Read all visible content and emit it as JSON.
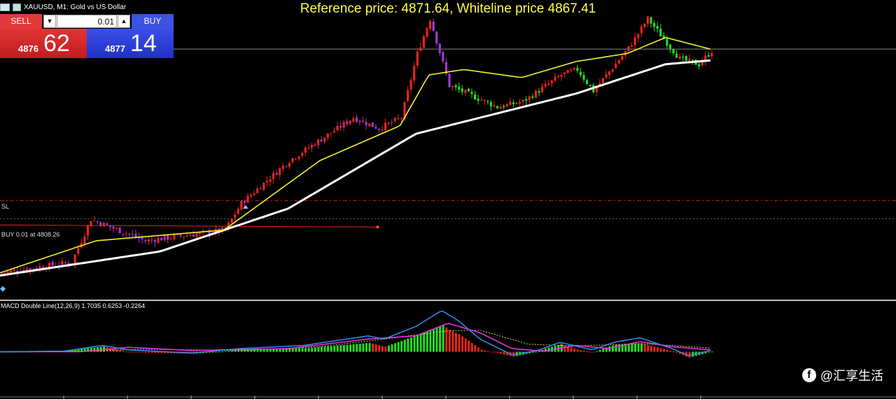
{
  "window": {
    "symbol_title": "XAUUSD, M1:  Gold vs US Dollar"
  },
  "header_text": "Reference price: 4871.64, Whiteline price 4867.41",
  "trade_panel": {
    "sell_label": "SELL",
    "buy_label": "BUY",
    "lot_value": "0.01",
    "down_arrow": "▼",
    "up_arrow": "▲",
    "sell_small": "4876",
    "sell_big": "62",
    "buy_small": "4877",
    "buy_big": "14",
    "sell_color": "#e23a3a",
    "buy_color": "#3e52e0"
  },
  "levels": {
    "sl_label": "SL",
    "buy_label": "BUY 0.01 at 4808.26"
  },
  "macd_label": "MACD Double Line(12,26,9) 1.7035 0.6253 -0.2264",
  "watermark": {
    "icon": "facebook-icon",
    "text": "@汇享生活"
  },
  "colors": {
    "bull": "#e8231d",
    "bear_late": "#22dd22",
    "bear_early": "#9b3bd1",
    "white_ma": "#ffffff",
    "yellow_ma": "#f3f02a",
    "macd_line": "#3a8ce8",
    "signal_line": "#ee33ee",
    "dotted_line": "#d8d860"
  },
  "chart_data": [
    {
      "type": "candlestick",
      "description": "XAUUSD M1 price",
      "anchor_points": [
        {
          "x": 0,
          "close": 4788
        },
        {
          "x": 22,
          "close": 4792
        },
        {
          "x": 28,
          "close": 4808
        },
        {
          "x": 45,
          "close": 4800
        },
        {
          "x": 70,
          "close": 4804
        },
        {
          "x": 75,
          "close": 4814
        },
        {
          "x": 90,
          "close": 4830
        },
        {
          "x": 110,
          "close": 4846
        },
        {
          "x": 118,
          "close": 4842
        },
        {
          "x": 125,
          "close": 4846
        },
        {
          "x": 130,
          "close": 4870
        },
        {
          "x": 134,
          "close": 4883
        },
        {
          "x": 140,
          "close": 4858
        },
        {
          "x": 155,
          "close": 4850
        },
        {
          "x": 163,
          "close": 4852
        },
        {
          "x": 175,
          "close": 4862
        },
        {
          "x": 180,
          "close": 4864
        },
        {
          "x": 185,
          "close": 4856
        },
        {
          "x": 196,
          "close": 4872
        },
        {
          "x": 202,
          "close": 4883
        },
        {
          "x": 206,
          "close": 4877
        },
        {
          "x": 212,
          "close": 4868
        },
        {
          "x": 218,
          "close": 4866
        },
        {
          "x": 222,
          "close": 4871
        }
      ],
      "white_ma": [
        {
          "x": 0,
          "v": 4787
        },
        {
          "x": 50,
          "v": 4796
        },
        {
          "x": 90,
          "v": 4812
        },
        {
          "x": 130,
          "v": 4840
        },
        {
          "x": 180,
          "v": 4855
        },
        {
          "x": 208,
          "v": 4866
        },
        {
          "x": 222,
          "v": 4867.41
        }
      ],
      "yellow_ma": [
        {
          "x": 0,
          "v": 4788
        },
        {
          "x": 30,
          "v": 4800
        },
        {
          "x": 70,
          "v": 4804
        },
        {
          "x": 100,
          "v": 4830
        },
        {
          "x": 125,
          "v": 4843
        },
        {
          "x": 134,
          "v": 4862
        },
        {
          "x": 145,
          "v": 4864
        },
        {
          "x": 163,
          "v": 4861
        },
        {
          "x": 180,
          "v": 4867
        },
        {
          "x": 196,
          "v": 4870
        },
        {
          "x": 208,
          "v": 4876
        },
        {
          "x": 222,
          "v": 4871.64
        }
      ],
      "reference_price": 4871.64,
      "whiteline_price": 4867.41,
      "entry_price": 4808.26,
      "sl_price": 4815,
      "ylim": [
        4778,
        4890
      ],
      "xlim": [
        0,
        280
      ]
    },
    {
      "type": "macd",
      "params": "(12,26,9)",
      "values": {
        "main": 1.7035,
        "signal": 0.6253,
        "hist": -0.2264
      },
      "macd_line": [
        {
          "x": 0,
          "v": 0.0
        },
        {
          "x": 20,
          "v": 0.1
        },
        {
          "x": 32,
          "v": 1.0
        },
        {
          "x": 40,
          "v": 0.3
        },
        {
          "x": 60,
          "v": -0.2
        },
        {
          "x": 75,
          "v": 0.5
        },
        {
          "x": 95,
          "v": 1.0
        },
        {
          "x": 115,
          "v": 2.5
        },
        {
          "x": 120,
          "v": 2.0
        },
        {
          "x": 130,
          "v": 4.0
        },
        {
          "x": 138,
          "v": 6.5
        },
        {
          "x": 143,
          "v": 5.0
        },
        {
          "x": 150,
          "v": 2.0
        },
        {
          "x": 160,
          "v": -0.5
        },
        {
          "x": 168,
          "v": 0.2
        },
        {
          "x": 175,
          "v": 1.5
        },
        {
          "x": 185,
          "v": 0.3
        },
        {
          "x": 192,
          "v": 1.5
        },
        {
          "x": 200,
          "v": 2.2
        },
        {
          "x": 210,
          "v": 0.5
        },
        {
          "x": 215,
          "v": -0.6
        },
        {
          "x": 222,
          "v": 0.2
        }
      ],
      "signal_line": [
        {
          "x": 0,
          "v": 0.0
        },
        {
          "x": 25,
          "v": 0.0
        },
        {
          "x": 40,
          "v": 0.7
        },
        {
          "x": 60,
          "v": 0.2
        },
        {
          "x": 90,
          "v": 0.5
        },
        {
          "x": 115,
          "v": 2.0
        },
        {
          "x": 130,
          "v": 2.5
        },
        {
          "x": 140,
          "v": 4.5
        },
        {
          "x": 150,
          "v": 3.0
        },
        {
          "x": 160,
          "v": 0.5
        },
        {
          "x": 170,
          "v": 0.1
        },
        {
          "x": 180,
          "v": 1.0
        },
        {
          "x": 190,
          "v": 0.5
        },
        {
          "x": 200,
          "v": 1.6
        },
        {
          "x": 210,
          "v": 0.8
        },
        {
          "x": 222,
          "v": 0.3
        }
      ],
      "dotted_line": [
        {
          "x": 0,
          "v": 0.0
        },
        {
          "x": 25,
          "v": 0.1
        },
        {
          "x": 45,
          "v": 0.4
        },
        {
          "x": 75,
          "v": 0.2
        },
        {
          "x": 100,
          "v": 0.8
        },
        {
          "x": 120,
          "v": 2.0
        },
        {
          "x": 140,
          "v": 3.3
        },
        {
          "x": 150,
          "v": 3.4
        },
        {
          "x": 165,
          "v": 1.2
        },
        {
          "x": 180,
          "v": 0.9
        },
        {
          "x": 200,
          "v": 1.3
        },
        {
          "x": 222,
          "v": 0.6
        }
      ],
      "ylim": [
        -7,
        8
      ]
    }
  ]
}
